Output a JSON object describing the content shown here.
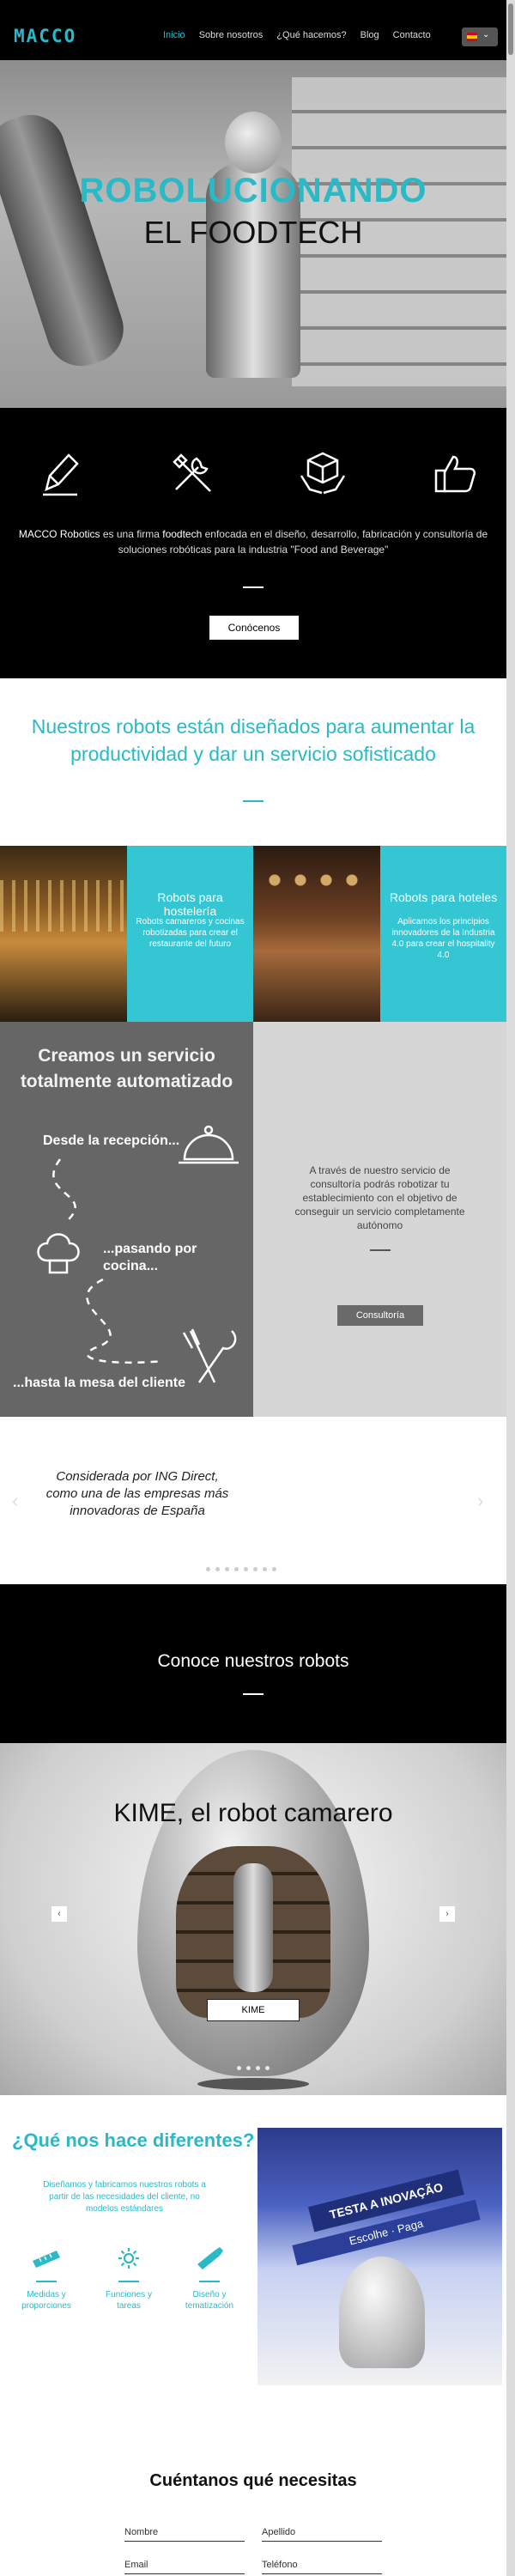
{
  "header": {
    "logo": "MACCO",
    "nav": [
      "Inicio",
      "Sobre nosotros",
      "¿Qué hacemos?",
      "Blog",
      "Contacto"
    ],
    "active_nav": "Inicio",
    "language": "es"
  },
  "hero": {
    "title_line1": "ROBOLUCIONANDO",
    "title_line2": "EL FOODTECH"
  },
  "intro": {
    "icons": [
      "pen-icon",
      "tools-icon",
      "box-hands-icon",
      "thumbs-up-icon"
    ],
    "text_prefix": "MACCO Robotics",
    "text_mid1": " es una firma ",
    "text_bold": "foodtech",
    "text_rest": " enfocada en el diseño, desarrollo, fabricación y consultoría de soluciones robóticas para la industria \"Food and Beverage\"",
    "button": "Conócenos"
  },
  "robots_heading": "Nuestros robots están diseñados para aumentar la productividad y dar un servicio sofisticado",
  "tiles": [
    {
      "title": "Robots para hostelería",
      "text": "Robots camareros y cocinas robotizadas para crear el restaurante del futuro"
    },
    {
      "title": "Robots para hoteles",
      "text": "Aplicamos los principios innovadores de la Industria 4.0 para crear el hospitality 4.0"
    }
  ],
  "automation": {
    "title": "Creamos un servicio totalmente automatizado",
    "step1": "Desde la recepción...",
    "step2": "...pasando por cocina...",
    "step3": "...hasta la mesa del cliente",
    "description": "A través de nuestro servicio de consultoría podrás robotizar tu establecimiento con el objetivo de conseguir un servicio completamente autónomo",
    "button": "Consultoría"
  },
  "testimonial": {
    "quote": "Considerada por ING Direct, como una de las empresas más innovadoras de España",
    "dots": 8
  },
  "conoce": {
    "title": "Conoce nuestros robots"
  },
  "kime": {
    "title": "KIME, el robot camarero",
    "button": "KIME",
    "prev": "‹",
    "next": "›",
    "dots": 4
  },
  "diferentes": {
    "title": "¿Qué nos hace diferentes?",
    "text": "Diseñamos y fabricamos nuestros robots a partir de las necesidades del cliente, no modelos estándares",
    "features": [
      {
        "icon": "ruler-icon",
        "label": "Medidas y proporciones"
      },
      {
        "icon": "gear-icon",
        "label": "Funciones y tareas"
      },
      {
        "icon": "brush-icon",
        "label": "Diseño y tematización"
      }
    ],
    "photo_banner1": "TESTA A INOVAÇÃO",
    "photo_banner2": "Escolhe · Paga"
  },
  "contact": {
    "title": "Cuéntanos qué necesitas",
    "fields": [
      {
        "placeholder": "Nombre"
      },
      {
        "placeholder": "Apellido"
      },
      {
        "placeholder": "Email"
      },
      {
        "placeholder": "Teléfono"
      }
    ]
  },
  "colors": {
    "accent": "#2ab9c6",
    "tile": "#35c6d4",
    "dark": "#000000",
    "grey": "#666666"
  }
}
